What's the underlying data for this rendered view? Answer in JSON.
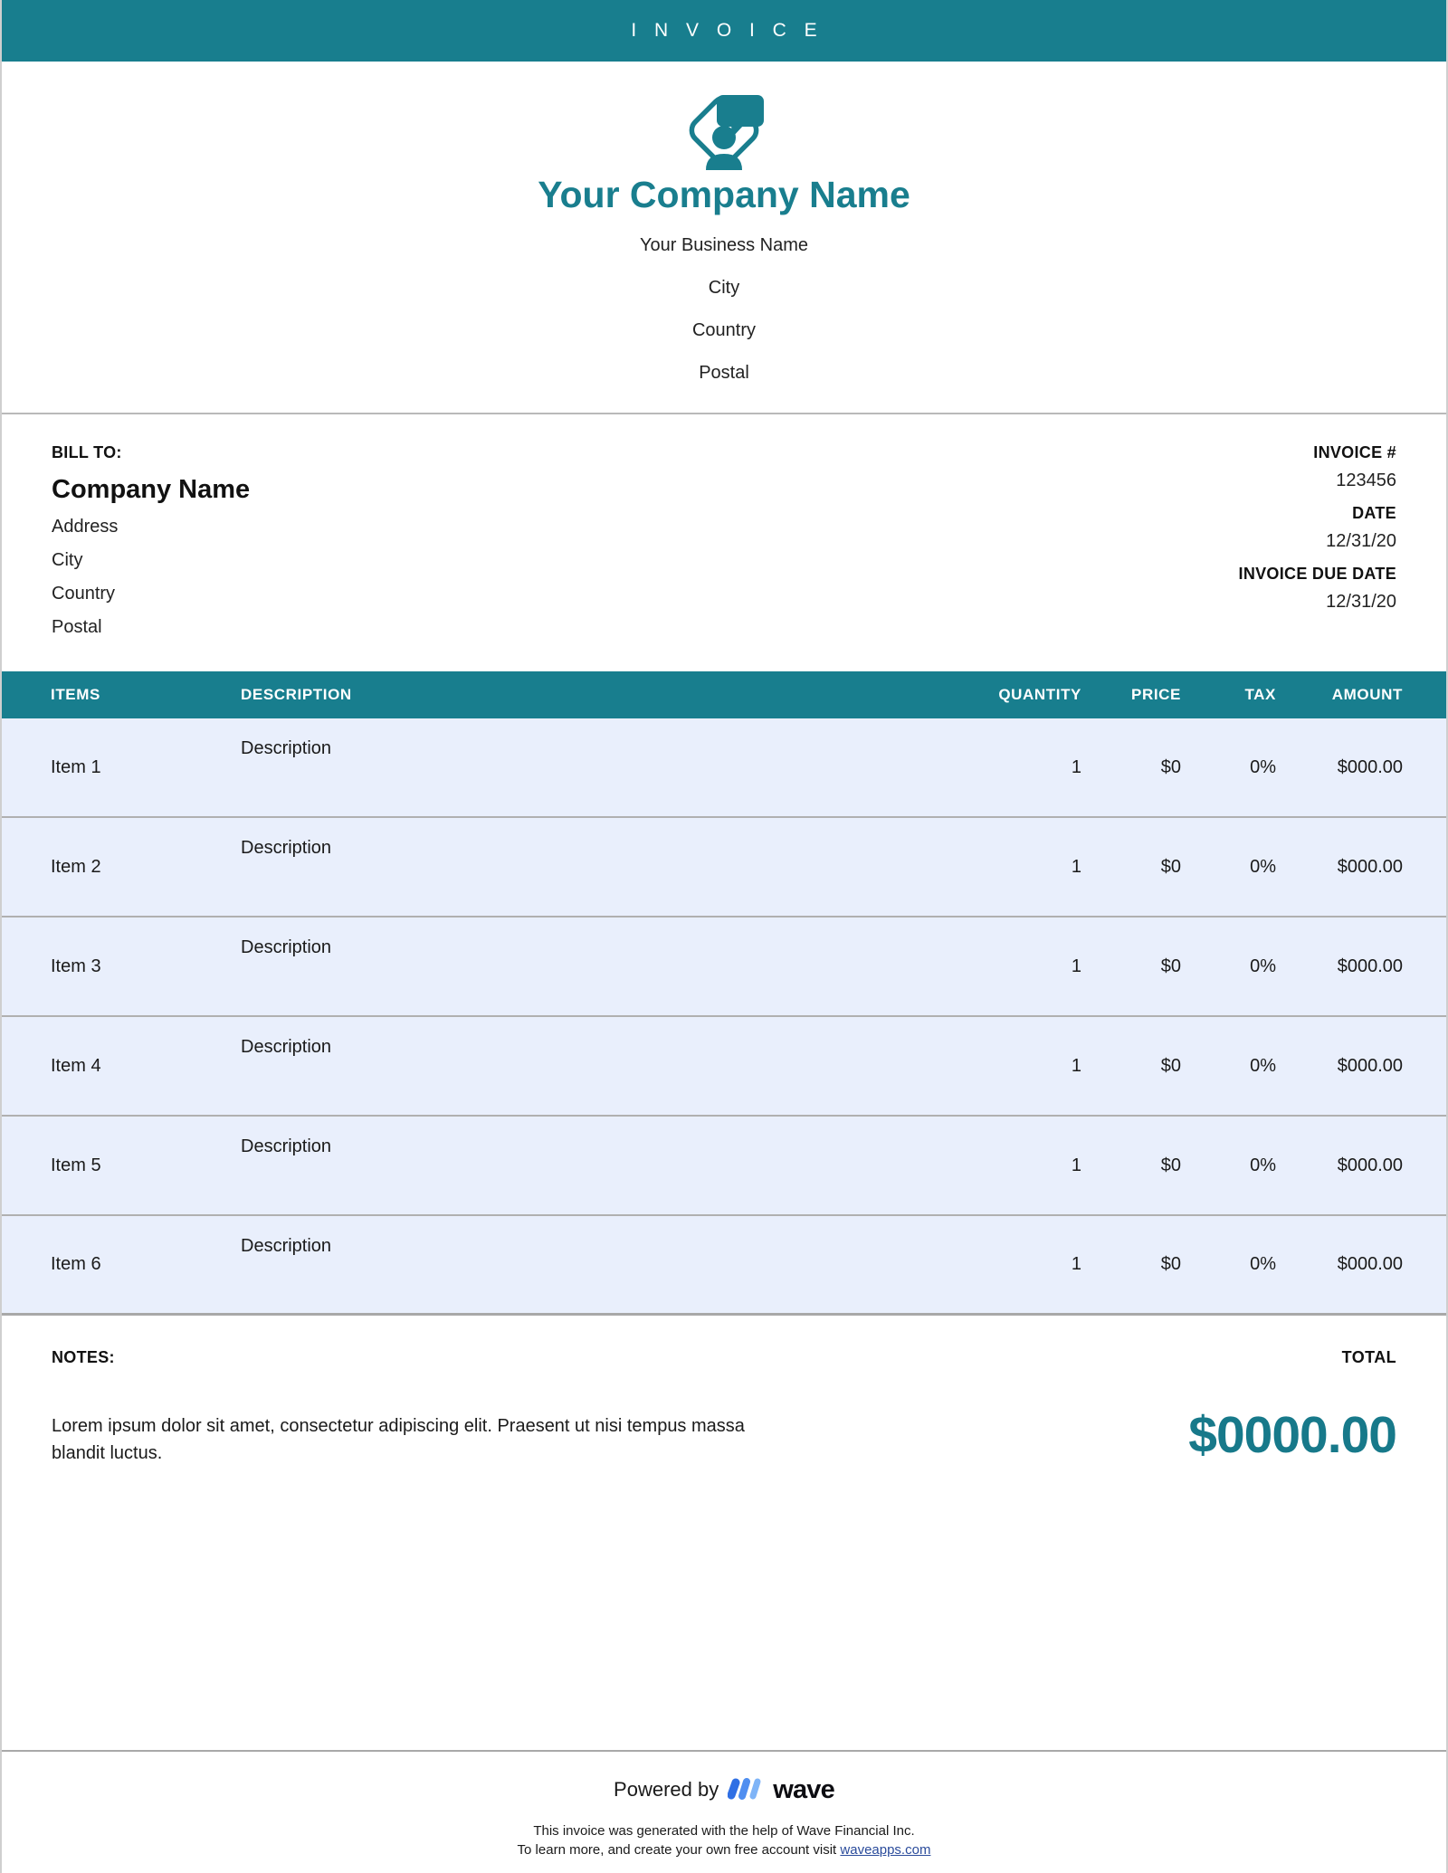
{
  "topbar": {
    "title": "I N V O I C E"
  },
  "brand": {
    "logo_icon": "person-speech-bubble-diamond-logo",
    "company_name": "Your Company Name",
    "lines": [
      "Your Business Name",
      "City",
      "Country",
      "Postal"
    ]
  },
  "bill_to": {
    "label": "BILL TO:",
    "company": "Company Name",
    "lines": [
      "Address",
      "City",
      "Country",
      "Postal"
    ]
  },
  "invoice_meta": [
    {
      "label": "INVOICE #",
      "value": "123456"
    },
    {
      "label": "DATE",
      "value": "12/31/20"
    },
    {
      "label": "INVOICE DUE DATE",
      "value": "12/31/20"
    }
  ],
  "table": {
    "headers": {
      "items": "ITEMS",
      "description": "DESCRIPTION",
      "quantity": "QUANTITY",
      "price": "PRICE",
      "tax": "TAX",
      "amount": "AMOUNT"
    },
    "rows": [
      {
        "item": "Item 1",
        "description": "Description",
        "quantity": "1",
        "price": "$0",
        "tax": "0%",
        "amount": "$000.00"
      },
      {
        "item": "Item 2",
        "description": "Description",
        "quantity": "1",
        "price": "$0",
        "tax": "0%",
        "amount": "$000.00"
      },
      {
        "item": "Item 3",
        "description": "Description",
        "quantity": "1",
        "price": "$0",
        "tax": "0%",
        "amount": "$000.00"
      },
      {
        "item": "Item 4",
        "description": "Description",
        "quantity": "1",
        "price": "$0",
        "tax": "0%",
        "amount": "$000.00"
      },
      {
        "item": "Item 5",
        "description": "Description",
        "quantity": "1",
        "price": "$0",
        "tax": "0%",
        "amount": "$000.00"
      },
      {
        "item": "Item 6",
        "description": "Description",
        "quantity": "1",
        "price": "$0",
        "tax": "0%",
        "amount": "$000.00"
      }
    ]
  },
  "notes": {
    "label": "NOTES:",
    "body": "Lorem ipsum dolor sit amet, consectetur adipiscing elit. Praesent ut nisi tempus massa blandit luctus."
  },
  "total": {
    "label": "TOTAL",
    "amount": "$0000.00"
  },
  "footer": {
    "powered_by": "Powered by",
    "wave_mark_icon": "wave-logo-icon",
    "wave_wordmark": "wave",
    "line1": "This invoice was generated with the help of Wave Financial Inc.",
    "line2_prefix": "To learn more, and create your own free account visit ",
    "link_text": "waveapps.com"
  },
  "colors": {
    "teal": "#187e8e",
    "row_blue": "#e9effc",
    "total_teal": "#17798a",
    "link_blue": "#2a4b9b",
    "wave_blue_dark": "#2f6fe4",
    "wave_blue_light": "#6fa8f5"
  }
}
